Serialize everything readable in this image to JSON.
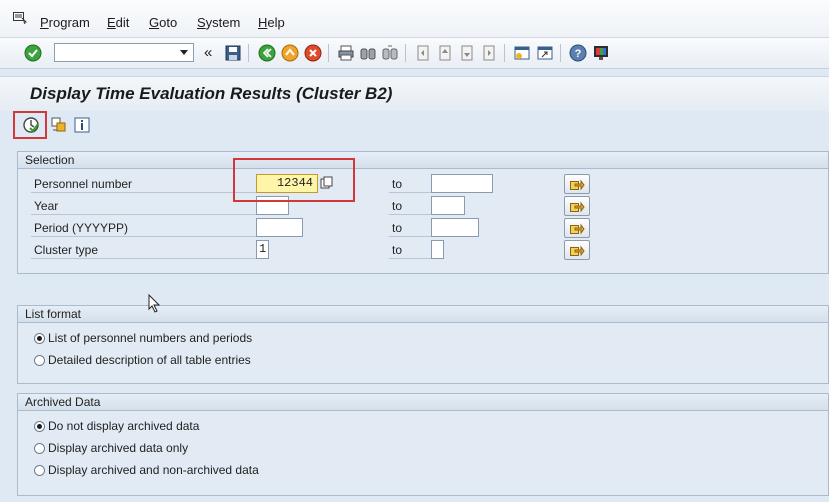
{
  "menu": {
    "items": [
      {
        "label": "Program",
        "accel": "P"
      },
      {
        "label": "Edit",
        "accel": "E"
      },
      {
        "label": "Goto",
        "accel": "G"
      },
      {
        "label": "System",
        "accel": "S"
      },
      {
        "label": "Help",
        "accel": "H"
      }
    ]
  },
  "toolbar": {
    "command_value": "",
    "back_glyph": "«"
  },
  "title": "Display Time Evaluation Results (Cluster B2)",
  "selection": {
    "header": "Selection",
    "to_label": "to",
    "rows": [
      {
        "label": "Personnel number",
        "from": "12344",
        "to": ""
      },
      {
        "label": "Year",
        "from": "",
        "to": ""
      },
      {
        "label": "Period (YYYYPP)",
        "from": "",
        "to": ""
      },
      {
        "label": "Cluster type",
        "from": "1",
        "to": ""
      }
    ]
  },
  "list_format": {
    "header": "List format",
    "options": [
      {
        "label": "List of personnel numbers and periods",
        "selected": true
      },
      {
        "label": "Detailed description of all table entries",
        "selected": false
      }
    ]
  },
  "archived": {
    "header": "Archived Data",
    "options": [
      {
        "label": "Do not display archived data",
        "selected": true
      },
      {
        "label": "Display archived data only",
        "selected": false
      },
      {
        "label": "Display archived and non-archived data",
        "selected": false
      }
    ]
  },
  "colors": {
    "highlight": "#d0383a",
    "active_field": "#fff5a8",
    "background": "#dfe9f3"
  }
}
